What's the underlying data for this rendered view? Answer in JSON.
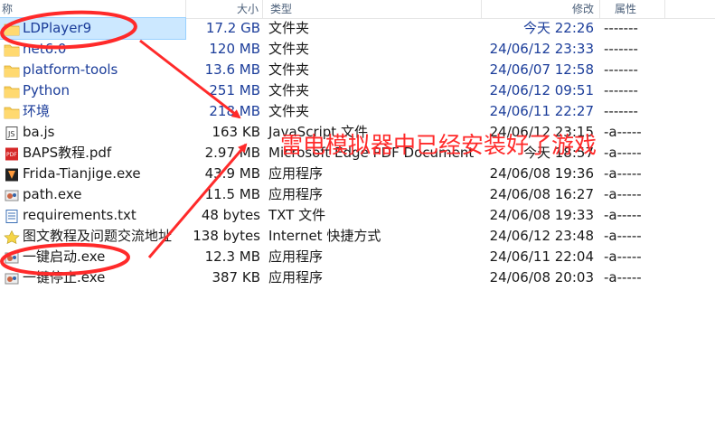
{
  "header": {
    "name_label": "称",
    "size_label": "大小",
    "type_label": "类型",
    "modified_label": "修改",
    "attr_label": "属性"
  },
  "files": [
    {
      "name": "LDPlayer9",
      "size": "17.2 GB",
      "type": "文件夹",
      "modified": "今天 22:26",
      "attr": "-------",
      "icon": "folder-icon",
      "blue": true,
      "selected": true
    },
    {
      "name": "net6.0",
      "size": "120 MB",
      "type": "文件夹",
      "modified": "24/06/12 23:33",
      "attr": "-------",
      "icon": "folder-icon",
      "blue": true
    },
    {
      "name": "platform-tools",
      "size": "13.6 MB",
      "type": "文件夹",
      "modified": "24/06/07 12:58",
      "attr": "-------",
      "icon": "folder-icon",
      "blue": true
    },
    {
      "name": "Python",
      "size": "251 MB",
      "type": "文件夹",
      "modified": "24/06/12 09:51",
      "attr": "-------",
      "icon": "folder-icon",
      "blue": true
    },
    {
      "name": "环境",
      "size": "218 MB",
      "type": "文件夹",
      "modified": "24/06/11 22:27",
      "attr": "-------",
      "icon": "folder-icon",
      "blue": true
    },
    {
      "name": "ba.js",
      "size": "163 KB",
      "type": "JavaScript 文件",
      "modified": "24/06/12 23:15",
      "attr": "-a-----",
      "icon": "js-file-icon"
    },
    {
      "name": "BAPS教程.pdf",
      "size": "2.97 MB",
      "type": "Microsoft Edge PDF Document",
      "modified": "今天 18:57",
      "attr": "-a-----",
      "icon": "pdf-file-icon"
    },
    {
      "name": "Frida-Tianjige.exe",
      "size": "43.9 MB",
      "type": "应用程序",
      "modified": "24/06/08 19:36",
      "attr": "-a-----",
      "icon": "frida-exe-icon"
    },
    {
      "name": "path.exe",
      "size": "11.5 MB",
      "type": "应用程序",
      "modified": "24/06/08 16:27",
      "attr": "-a-----",
      "icon": "exe-file-icon"
    },
    {
      "name": "requirements.txt",
      "size": "48 bytes",
      "type": "TXT 文件",
      "modified": "24/06/08 19:33",
      "attr": "-a-----",
      "icon": "txt-file-icon"
    },
    {
      "name": "图文教程及问题交流地址",
      "size": "138 bytes",
      "type": "Internet 快捷方式",
      "modified": "24/06/12 23:48",
      "attr": "-a-----",
      "icon": "internet-shortcut-icon"
    },
    {
      "name": "一键启动.exe",
      "size": "12.3 MB",
      "type": "应用程序",
      "modified": "24/06/11 22:04",
      "attr": "-a-----",
      "icon": "exe-file-icon"
    },
    {
      "name": "一键停止.exe",
      "size": "387 KB",
      "type": "应用程序",
      "modified": "24/06/08 20:03",
      "attr": "-a-----",
      "icon": "exe-file-icon"
    }
  ],
  "annotation": {
    "text": "雷电模拟器中已经安装好了游戏",
    "color": "#ff2a2a"
  }
}
